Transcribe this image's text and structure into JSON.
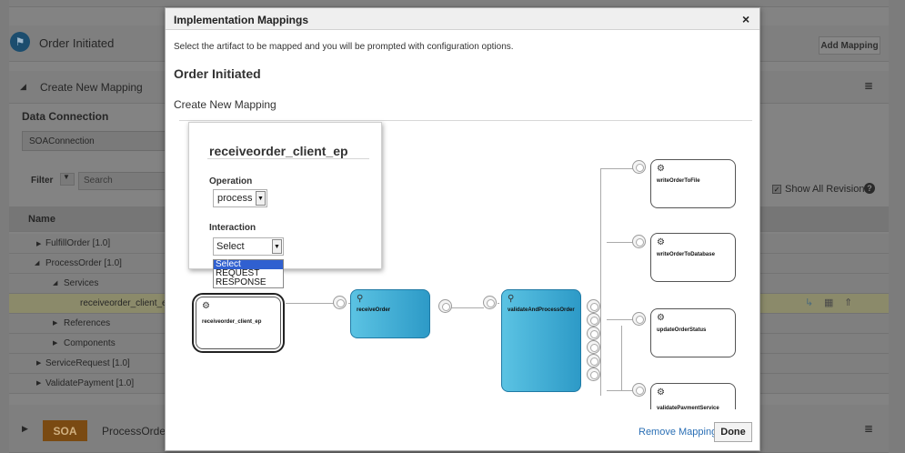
{
  "background": {
    "stage_title": "Order Initiated",
    "section_title": "Create New Mapping",
    "data_connection_label": "Data Connection",
    "connection_value": "SOAConnection",
    "filter_label": "Filter",
    "search_placeholder": "Search",
    "add_mapping_label": "Add Mapping",
    "show_all_revisions_label": "Show All Revisions",
    "tree_header": "Name",
    "tree": [
      {
        "label": "FulfillOrder [1.0]",
        "expander": "▶"
      },
      {
        "label": "ProcessOrder [1.0]",
        "expander": "◢"
      },
      {
        "label": "Services",
        "expander": "◢"
      },
      {
        "label": "receiveorder_client_ep",
        "expander": ""
      },
      {
        "label": "References",
        "expander": "▶"
      },
      {
        "label": "Components",
        "expander": "▶"
      },
      {
        "label": "ServiceRequest [1.0]",
        "expander": "▶"
      },
      {
        "label": "ValidatePayment [1.0]",
        "expander": "▶"
      }
    ],
    "soa_badge": "SOA",
    "footer_item": "ProcessOrder"
  },
  "dialog": {
    "title": "Implementation Mappings",
    "close_glyph": "×",
    "instruction": "Select the artifact to be mapped and you will be prompted with configuration options.",
    "heading": "Order Initiated",
    "subheading": "Create New Mapping",
    "remove_mapping_label": "Remove Mapping",
    "done_label": "Done"
  },
  "composite": {
    "components": [
      {
        "label": "receiveorder_client_ep",
        "icon": "gear-icon"
      },
      {
        "label": "receiveOrder",
        "icon": "network-icon"
      },
      {
        "label": "validateAndProcessOrder",
        "icon": "network-icon"
      },
      {
        "label": "writeOrderToFile",
        "icon": "gear-icon"
      },
      {
        "label": "writeOrderToDatabase",
        "icon": "gear-icon"
      },
      {
        "label": "updateOrderStatus",
        "icon": "gear-icon"
      },
      {
        "label": "validatePaymentService",
        "icon": "gear-icon"
      }
    ]
  },
  "popup": {
    "title": "receiveorder_client_ep",
    "operation_label": "Operation",
    "operation_value": "process",
    "interaction_label": "Interaction",
    "interaction_value": "Select",
    "interaction_options": [
      "Select",
      "REQUEST",
      "RESPONSE"
    ]
  }
}
